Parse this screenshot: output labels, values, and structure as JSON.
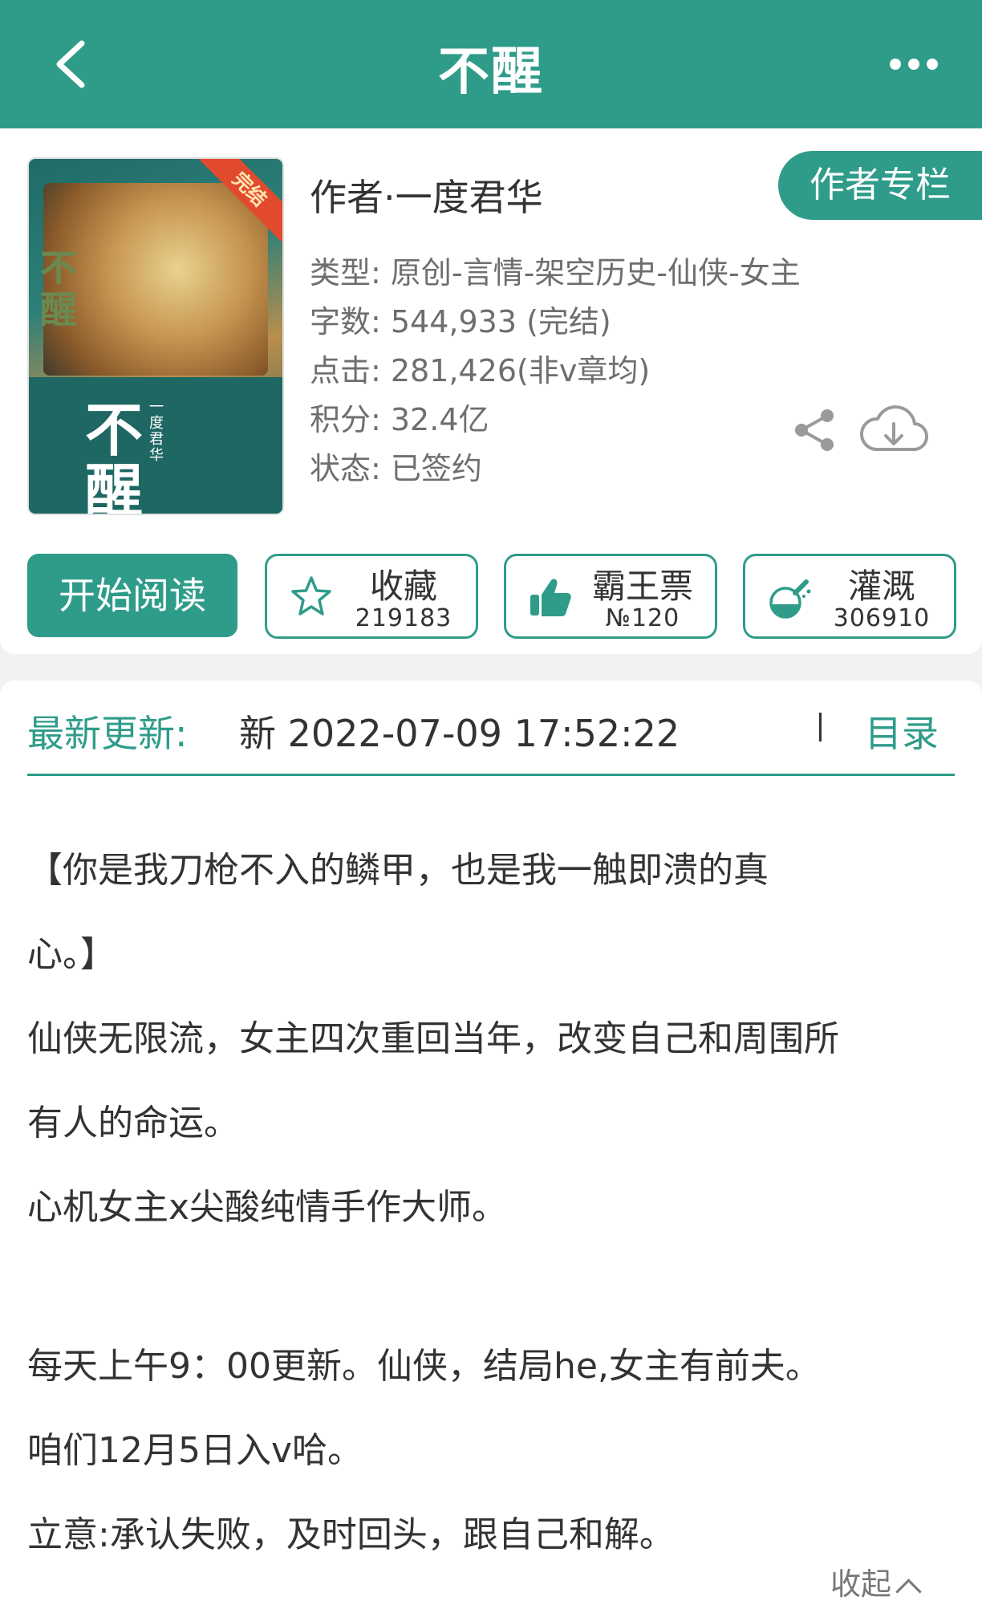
{
  "colors": {
    "brand": "#2f9c8a",
    "text": "#333333",
    "muted": "#6e6e6e"
  },
  "header": {
    "title": "不醒",
    "back_icon": "chevron-left-icon",
    "more_icon": "more-icon"
  },
  "book": {
    "cover": {
      "title": "不醒",
      "side_title": "不醒",
      "author": "一度君华",
      "ribbon": "完结"
    },
    "author_line": "作者·一度君华",
    "author_column_label": "作者专栏",
    "meta": [
      "类型: 原创-言情-架空历史-仙侠-女主",
      "字数: 544,933 (完结)",
      "点击: 281,426(非v章均)",
      "积分: 32.4亿",
      "状态: 已签约"
    ]
  },
  "actions": {
    "start_read": "开始阅读",
    "favorite": {
      "label": "收藏",
      "count": "219183",
      "icon": "star-icon"
    },
    "overlord_ticket": {
      "label": "霸王票",
      "count": "№120",
      "icon": "thumbs-up-icon"
    },
    "irrigate": {
      "label": "灌溉",
      "count": "306910",
      "icon": "flask-icon"
    }
  },
  "update": {
    "label": "最新更新:",
    "text": "新  2022-07-09 17:52:22",
    "catalog": "目录"
  },
  "description": {
    "lines": [
      "【你是我刀枪不入的鳞甲，也是我一触即溃的真",
      "心。】",
      "仙侠无限流，女主四次重回当年，改变自己和周围所",
      "有人的命运。",
      "心机女主x尖酸纯情手作大师。",
      "每天上午9：00更新。仙侠，结局he,女主有前夫。",
      "咱们12月5日入v哈。",
      "立意:承认失败，及时回头，跟自己和解。"
    ],
    "collapse": "收起"
  }
}
